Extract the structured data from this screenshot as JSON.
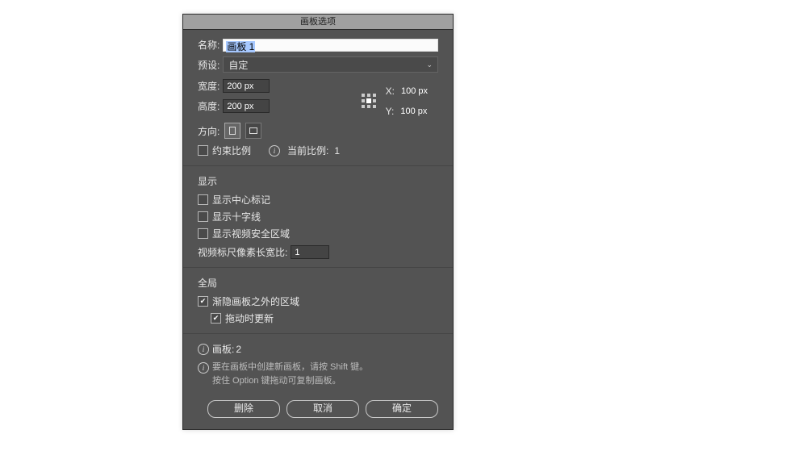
{
  "dialog": {
    "title": "画板选项",
    "name_label": "名称:",
    "name_value": "画板 1",
    "preset_label": "预设:",
    "preset_value": "自定",
    "width_label": "宽度:",
    "width_value": "200 px",
    "height_label": "高度:",
    "height_value": "200 px",
    "x_label": "X:",
    "x_value": "100 px",
    "y_label": "Y:",
    "y_value": "100 px",
    "orientation_label": "方向:",
    "constrain_label": "约束比例",
    "current_ratio_label": "当前比例:",
    "current_ratio_value": "1"
  },
  "display": {
    "section_title": "显示",
    "show_center": "显示中心标记",
    "show_cross": "显示十字线",
    "show_safe": "显示视频安全区域",
    "pixel_aspect_label": "视频标尺像素长宽比:",
    "pixel_aspect_value": "1"
  },
  "global": {
    "section_title": "全局",
    "fade_outside": "渐隐画板之外的区域",
    "update_on_drag": "拖动时更新"
  },
  "footer": {
    "artboards_label": "画板:",
    "artboards_count": "2",
    "hint_line1": "要在画板中创建新画板，请按 Shift 键。",
    "hint_line2": "按住 Option 键拖动可复制画板。",
    "delete": "删除",
    "cancel": "取消",
    "ok": "确定"
  }
}
